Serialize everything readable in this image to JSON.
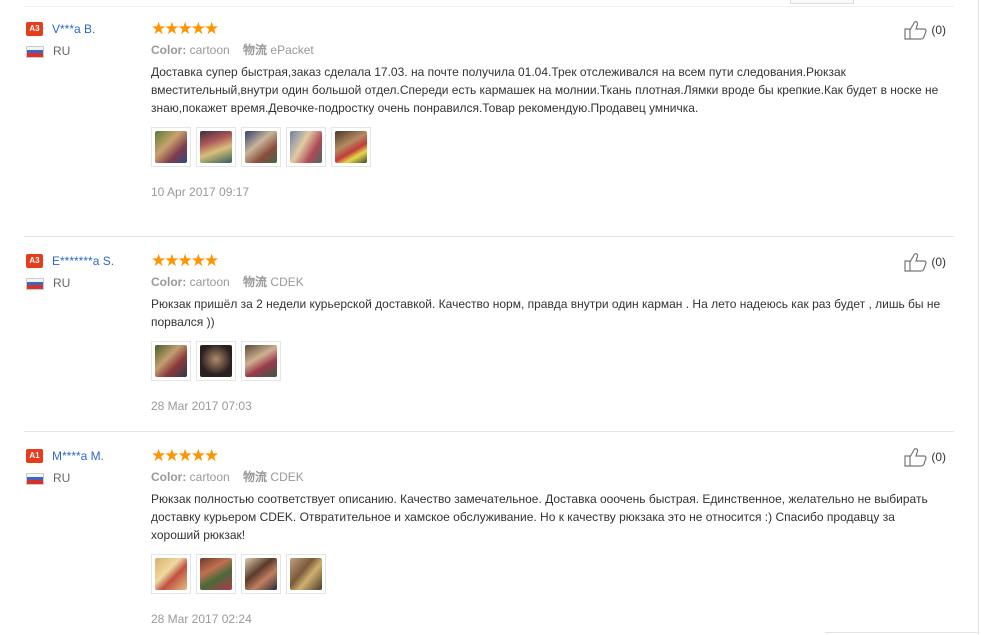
{
  "labels": {
    "color_label": "Color:",
    "shipping_label": "物流"
  },
  "reviews": [
    {
      "level": "A3",
      "name": "V***a B.",
      "country": "RU",
      "stars": "★★★★★",
      "color": "cartoon",
      "shipping": "ePacket",
      "text": "Доставка супер быстрая,заказ сделала 17.03. на почте получила 01.04.Трек отслеживался на всем пути следования.Рюкзак вместительный,внутри один большой отдел.Спереди есть кармашек на молнии.Ткань плотная.Лямки вроде бы крепкие.Как будет в носке не знаю,покажет время.Девочке-подростку очень понравился.Товар рекомендую.Продавец умничка.",
      "date": "10 Apr 2017 09:17",
      "likes": "(0)",
      "photos": 5
    },
    {
      "level": "A3",
      "name": "E*******a S.",
      "country": "RU",
      "stars": "★★★★★",
      "color": "cartoon",
      "shipping": "CDEK",
      "text": "Рюкзак пришёл за 2 недели курьерской доставкой. Качество норм, правда внутри один карман . На лето надеюсь как раз будет , лишь бы не порвался ))",
      "date": "28 Mar 2017 07:03",
      "likes": "(0)",
      "photos": 3
    },
    {
      "level": "A1",
      "name": "M****a M.",
      "country": "RU",
      "stars": "★★★★★",
      "color": "cartoon",
      "shipping": "CDEK",
      "text": "Рюкзак полностью соответствует описанию. Качество замечательное. Доставка ооочень быстрая. Единственное, желательно не выбирать доставку курьером CDEK. Отвратительное и хамское обслуживание. Но к качеству рюкзака это не относится :) Спасибо продавцу за хороший рюкзак!",
      "date": "28 Mar 2017 02:24",
      "likes": "(0)",
      "photos": 4
    }
  ],
  "colors": {
    "star": "#ff9400",
    "name_link": "#2a6bc5",
    "level_badge": "#e53d1c",
    "muted": "#999999"
  }
}
